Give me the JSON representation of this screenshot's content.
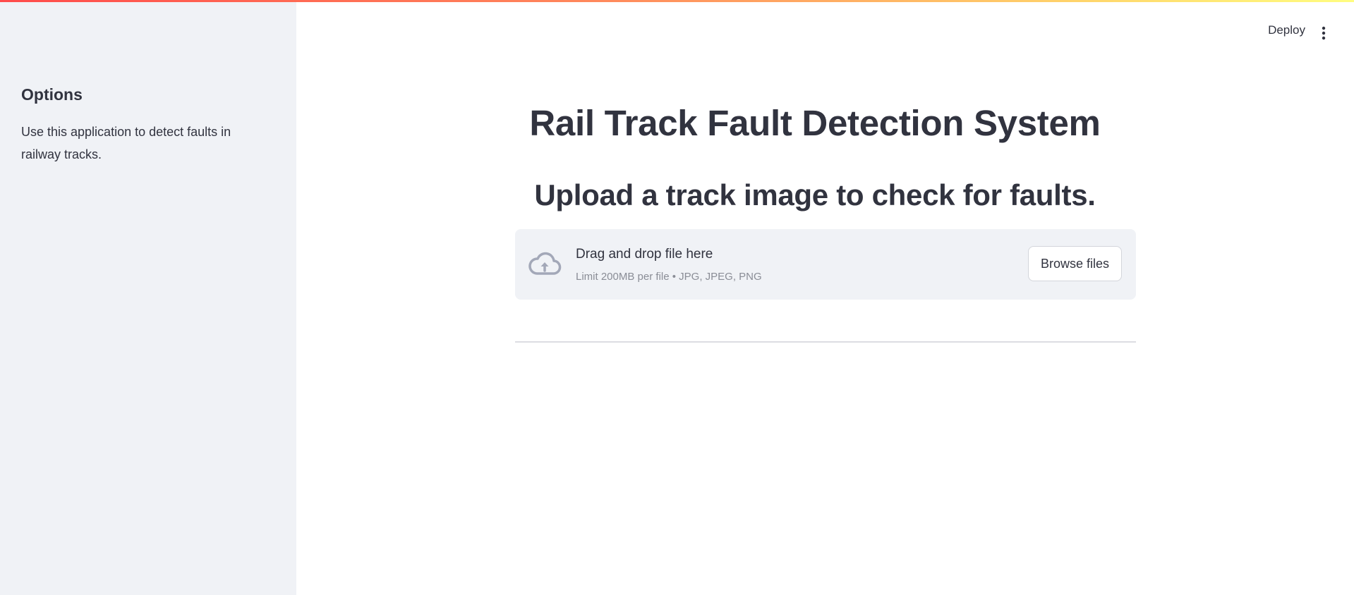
{
  "sidebar": {
    "title": "Options",
    "description": "Use this application to detect faults in railway tracks."
  },
  "header": {
    "deploy_label": "Deploy",
    "menu_icon": "vertical-ellipsis-icon"
  },
  "main": {
    "title": "Rail Track Fault Detection System",
    "subtitle": "Upload a track image to check for faults."
  },
  "uploader": {
    "icon": "cloud-upload-icon",
    "drop_label": "Drag and drop file here",
    "limit_text": "Limit 200MB per file • JPG, JPEG, PNG",
    "browse_label": "Browse files"
  },
  "colors": {
    "accent_gradient_start": "#ff4b4b",
    "accent_gradient_end": "#fffd80",
    "sidebar_bg": "#f0f2f6",
    "text": "#31333f"
  }
}
